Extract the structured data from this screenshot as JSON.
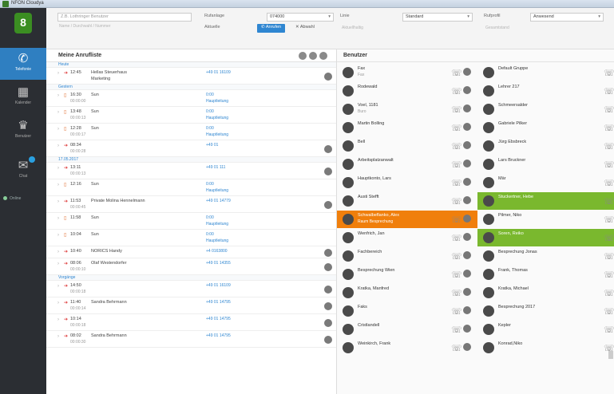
{
  "window": {
    "title": "NFON Cloudya"
  },
  "sidebar": {
    "items": [
      {
        "label": "Telefonie",
        "icon": "phone-icon"
      },
      {
        "label": "Kalender",
        "icon": "calendar-icon"
      },
      {
        "label": "Benutzer",
        "icon": "users-icon"
      },
      {
        "label": "Chat",
        "icon": "chat-icon"
      }
    ],
    "status": "Online"
  },
  "toolbar": {
    "search_placeholder": "Z.B. Lothringer Benutzer",
    "search_sub": "Name / Durchwahl / Nummer",
    "rufanlage_label": "Rufanlage",
    "rufanlage_value": "074000",
    "linie_label": "Linie",
    "linie_value": "Standard",
    "rufprofil_label": "Rufprofil",
    "rufprofil_value": "Anwesend",
    "aktuelle_label": "Aktuelle",
    "anrufen_label": "Anrufen",
    "abwahl_label": "Abwahl",
    "sub_faint1": "Aktuellhaltig",
    "sub_faint2": "Gesamtstand"
  },
  "calls": {
    "title": "Meine Anrufliste",
    "sections": [
      "Heute",
      "Gestern",
      "17.05.2017",
      "Vorgänge"
    ],
    "rows": [
      {
        "time": "12:45",
        "sub": "",
        "name": "Hellas Steuerhaus",
        "name2": "Marketing",
        "num": "+49 01 16109",
        "num2": "",
        "section": 0
      },
      {
        "time": "16:30",
        "sub": "00:00:00",
        "name": "Sun",
        "name2": "",
        "num": "0:00",
        "num2": "Hauptleitung",
        "section": 1
      },
      {
        "time": "13:48",
        "sub": "00:00:13",
        "name": "Sun",
        "name2": "",
        "num": "0:00",
        "num2": "Hauptleitung",
        "section": 1
      },
      {
        "time": "12:28",
        "sub": "00:00:17",
        "name": "Sun",
        "name2": "",
        "num": "0:00",
        "num2": "Hauptleitung",
        "section": 1
      },
      {
        "time": "08:34",
        "sub": "00:00:28",
        "name": "",
        "name2": "",
        "num": "+49 01",
        "num2": "",
        "section": 1
      },
      {
        "time": "13:11",
        "sub": "00:00:13",
        "name": "",
        "name2": "",
        "num": "+49 01 111",
        "num2": "",
        "section": 2
      },
      {
        "time": "12:16",
        "sub": "",
        "name": "Sun",
        "name2": "",
        "num": "0:00",
        "num2": "Hauptleitung",
        "section": 2
      },
      {
        "time": "11:53",
        "sub": "00:00:45",
        "name": "Private Molina Hennelmann",
        "name2": "",
        "num": "+49 01 14779",
        "num2": "",
        "section": 2
      },
      {
        "time": "11:58",
        "sub": "",
        "name": "Sun",
        "name2": "",
        "num": "0:00",
        "num2": "Hauptleitung",
        "section": 2
      },
      {
        "time": "10:04",
        "sub": "",
        "name": "Sun",
        "name2": "",
        "num": "0:00",
        "num2": "Hauptleitung",
        "section": 2
      },
      {
        "time": "10:40",
        "sub": "",
        "name": "NORICS Handy",
        "name2": "",
        "num": "+4 0163800",
        "num2": "",
        "section": 2
      },
      {
        "time": "08:06",
        "sub": "00:00:10",
        "name": "Olaf Westendorfer",
        "name2": "",
        "num": "+49 01 14355",
        "num2": "",
        "section": 2
      },
      {
        "time": "14:50",
        "sub": "00:00:18",
        "name": "",
        "name2": "",
        "num": "+49 01 16109",
        "num2": "",
        "section": 3
      },
      {
        "time": "11:40",
        "sub": "00:00:14",
        "name": "Sandra Behrmann",
        "name2": "",
        "num": "+49 01 14795",
        "num2": "",
        "section": 3
      },
      {
        "time": "10:14",
        "sub": "00:00:18",
        "name": "",
        "name2": "",
        "num": "+49 01 14795",
        "num2": "",
        "section": 3
      },
      {
        "time": "08:02",
        "sub": "00:00:30",
        "name": "Sandra Behrmann",
        "name2": "",
        "num": "+49 01 14795",
        "num2": "",
        "section": 3
      }
    ]
  },
  "users": {
    "title": "Benutzer",
    "left": [
      {
        "name": "Fax",
        "sub": "Fax"
      },
      {
        "name": "Rodewald",
        "sub": ""
      },
      {
        "name": "Voel, 1181",
        "sub": "Buro"
      },
      {
        "name": "Martin Bolling",
        "sub": ""
      },
      {
        "name": "Bell",
        "sub": ""
      },
      {
        "name": "Arbeitsplatzanwalt",
        "sub": ""
      },
      {
        "name": "Hauptkonto, Lars",
        "sub": ""
      },
      {
        "name": "Austi Stefft",
        "sub": ""
      },
      {
        "name": "Schwalbeflanko, Alex",
        "sub": "Raum Besprechung"
      },
      {
        "name": "Wenfrich, Jan",
        "sub": ""
      },
      {
        "name": "Fachbereich",
        "sub": ""
      },
      {
        "name": "Besprechung Wien",
        "sub": ""
      },
      {
        "name": "Kratka, Manfred",
        "sub": ""
      },
      {
        "name": "Faks",
        "sub": ""
      },
      {
        "name": "Cristlandell",
        "sub": ""
      },
      {
        "name": "Weinkirch, Frank",
        "sub": ""
      }
    ],
    "right": [
      {
        "name": "Default Gruppe",
        "sub": ""
      },
      {
        "name": "Lehrer 217",
        "sub": ""
      },
      {
        "name": "Schmeersalder",
        "sub": ""
      },
      {
        "name": "Gabriele Pilker",
        "sub": ""
      },
      {
        "name": "Jürg Ebsbreck",
        "sub": ""
      },
      {
        "name": "Lars Bruckner",
        "sub": ""
      },
      {
        "name": "Mär",
        "sub": ""
      },
      {
        "name": "Stuckertner, Hebe",
        "sub": ""
      },
      {
        "name": "Pilmer, Niko",
        "sub": ""
      },
      {
        "name": "Soren, Reiko",
        "sub": ""
      },
      {
        "name": "Besprechung Jonas",
        "sub": ""
      },
      {
        "name": "Frank, Thomas",
        "sub": ""
      },
      {
        "name": "Kratka, Michael",
        "sub": ""
      },
      {
        "name": "Besprechung 2017",
        "sub": ""
      },
      {
        "name": "Kepler",
        "sub": ""
      },
      {
        "name": "Konrad,Niko",
        "sub": ""
      }
    ]
  },
  "colors": {
    "accent": "#2f86d1",
    "orange": "#f07f0c",
    "green": "#7ab82e",
    "sidebar": "#2b2e33"
  }
}
